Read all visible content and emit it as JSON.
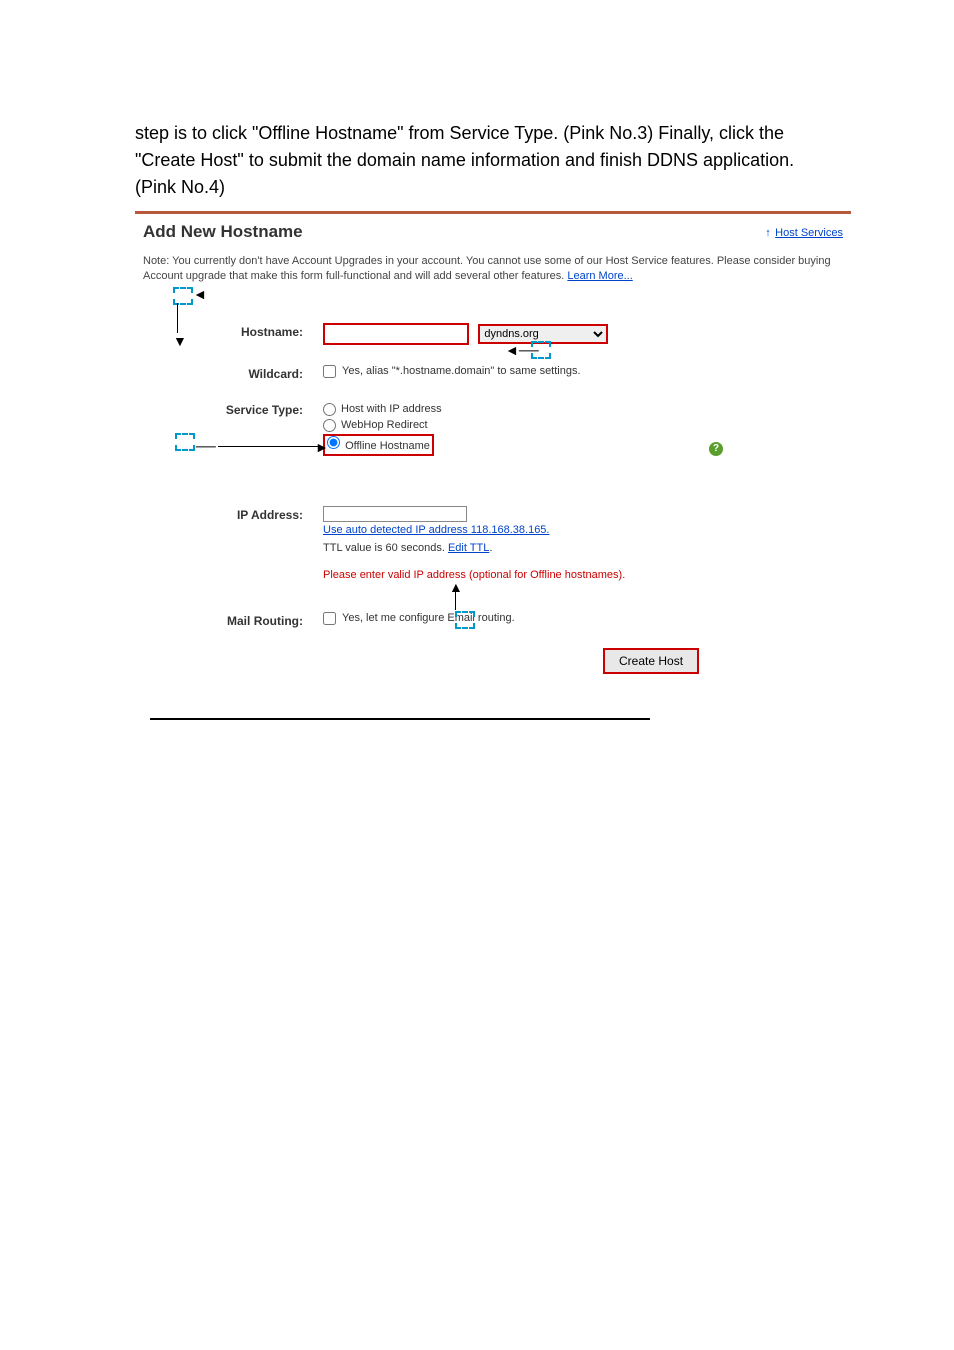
{
  "instruction": "step is to click \"Offline Hostname\" from Service Type. (Pink No.3) Finally, click the \"Create Host\" to submit the domain name information and finish DDNS application. (Pink No.4)",
  "page_title": "Add New Hostname",
  "host_services_link": "Host Services",
  "note": "Note: You currently don't have Account Upgrades in your account. You cannot use some of our Host Service features. Please consider buying Account upgrade that make this form full-functional and will add several other features. ",
  "learn_more": "Learn More...",
  "form": {
    "hostname_label": "Hostname:",
    "hostname_value": "",
    "domain_value": "dyndns.org",
    "wildcard_label": "Wildcard:",
    "wildcard_text": "Yes, alias \"*.hostname.domain\" to same settings.",
    "service_type_label": "Service Type:",
    "service_options": {
      "opt1": "Host with IP address",
      "opt2": "WebHop Redirect",
      "opt3": "Offline Hostname"
    },
    "ip_label": "IP Address:",
    "ip_value": "",
    "auto_detect_link": "Use auto detected IP address 118.168.38.165.",
    "ttl_text": "TTL value is 60 seconds. ",
    "edit_ttl": "Edit TTL",
    "ip_error": "Please enter valid IP address (optional for Offline hostnames).",
    "mail_label": "Mail Routing:",
    "mail_text": "Yes, let me configure Email routing.",
    "create_button": "Create Host"
  }
}
